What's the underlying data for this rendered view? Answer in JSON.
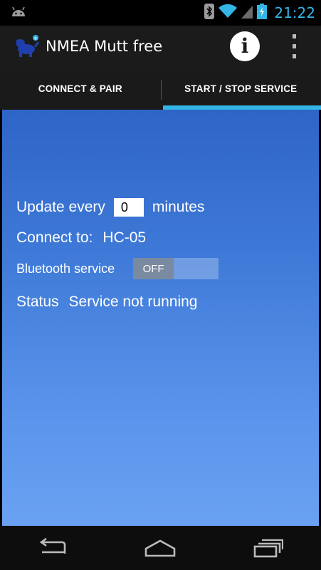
{
  "status_bar": {
    "time": "21:22",
    "icons": [
      "android-icon",
      "bluetooth-icon",
      "wifi-icon",
      "signal-icon",
      "battery-charging-icon"
    ]
  },
  "action_bar": {
    "title": "NMEA Mutt free",
    "icons": [
      "app-logo-icon",
      "info-icon",
      "overflow-menu-icon"
    ]
  },
  "tabs": [
    {
      "label": "CONNECT & PAIR",
      "selected": false
    },
    {
      "label": "START / STOP SERVICE",
      "selected": true
    }
  ],
  "main": {
    "update_label": "Update every",
    "update_value": "0",
    "update_unit": "minutes",
    "connect_label": "Connect to:",
    "connect_device": "HC-05",
    "bluetooth_label": "Bluetooth service",
    "bluetooth_toggle": "OFF",
    "status_label": "Status",
    "status_value": "Service not running"
  },
  "nav_bar": {
    "icons": [
      "back-icon",
      "home-icon",
      "recent-apps-icon"
    ]
  },
  "colors": {
    "accent": "#33b5e5",
    "content_gradient_top": "#2e64c6",
    "content_gradient_bottom": "#6aa1f2"
  }
}
